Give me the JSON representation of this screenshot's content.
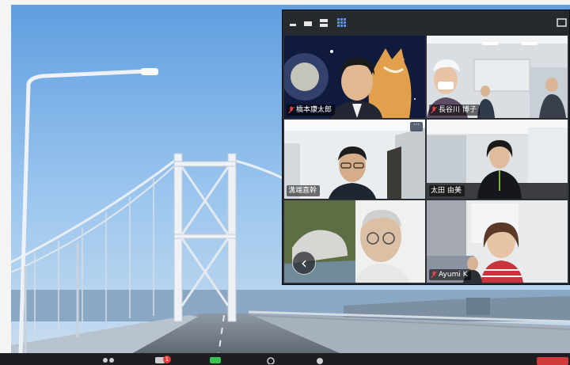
{
  "participants": [
    {
      "name": "橋本康太郎",
      "mic_muted": true
    },
    {
      "name": "長谷川 博子",
      "mic_muted": true
    },
    {
      "name": "溝端直幹",
      "mic_muted": false
    },
    {
      "name": "太田 由美",
      "mic_muted": false
    },
    {
      "name": "",
      "mic_muted": false
    },
    {
      "name": "Ayumi K",
      "mic_muted": true
    }
  ],
  "tile_menu_label": "···",
  "prev_page_label": "‹",
  "bottom_bar": {
    "chat_badge": "1"
  },
  "colors": {
    "window_bg": "#2a2d33",
    "toolbar_bg": "#26292e",
    "muted_mic": "#e54848",
    "end_button": "#d23b3b"
  },
  "icons": [
    "minimize-icon",
    "tile-view-icon",
    "speaker-view-icon",
    "gallery-view-icon",
    "fullscreen-icon",
    "mic-muted-icon",
    "prev-page-icon",
    "more-options-icon"
  ]
}
